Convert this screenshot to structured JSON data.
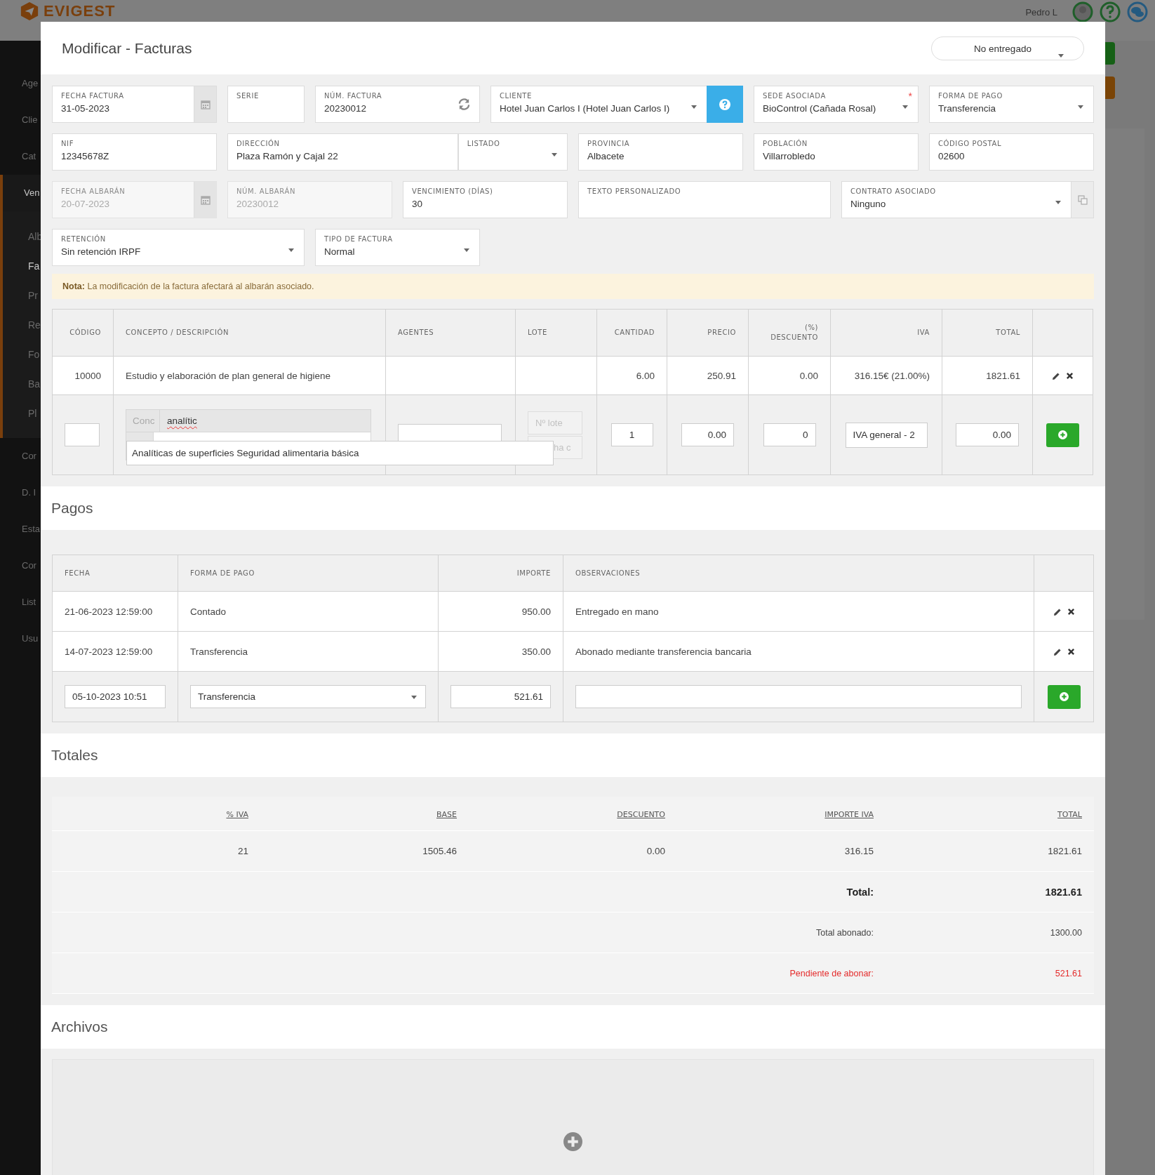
{
  "app": {
    "logo": "EVIGEST",
    "user": "Pedro L",
    "sidebar": [
      {
        "label": "Age",
        "selected": false
      },
      {
        "label": "Clie",
        "selected": false
      },
      {
        "label": "Cat",
        "selected": false
      },
      {
        "label": "Ven",
        "selected": true,
        "children": [
          {
            "label": "Alb",
            "selected": false
          },
          {
            "label": "Fa",
            "selected": true
          },
          {
            "label": "Pr",
            "selected": false
          },
          {
            "label": "Re",
            "selected": false
          },
          {
            "label": "Fo",
            "selected": false
          },
          {
            "label": "Ba",
            "selected": false
          },
          {
            "label": "Pl",
            "selected": false
          }
        ]
      },
      {
        "label": "Cor",
        "selected": false
      },
      {
        "label": "D. I",
        "selected": false
      },
      {
        "label": "Esta",
        "selected": false
      },
      {
        "label": "Cor",
        "selected": false
      },
      {
        "label": "List",
        "selected": false
      },
      {
        "label": "Usu",
        "selected": false
      }
    ]
  },
  "invoice": {
    "title": "Modificar - Facturas",
    "status": "No entregado",
    "required_symbol": "*",
    "form_rows": [
      [
        {
          "kind": "date",
          "label": "FECHA FACTURA",
          "value": "31-05-2023",
          "required": false,
          "disabled": false
        },
        {
          "kind": "text",
          "label": "SERIE",
          "required": false,
          "disabled": false
        },
        {
          "kind": "refresh",
          "label": "NÚM. FACTURA",
          "value": "20230012",
          "required": false,
          "disabled": false
        },
        {
          "kind": "client",
          "label": "CLIENTE",
          "value": "Hotel Juan Carlos I (Hotel Juan Carlos I)",
          "required": false,
          "disabled": false
        },
        {
          "kind": "select",
          "label": "SEDE ASOCIADA",
          "value": "BioControl (Cañada Rosal)",
          "required": true,
          "disabled": false
        },
        {
          "kind": "select",
          "label": "FORMA DE PAGO",
          "value": "Transferencia",
          "required": false,
          "disabled": false
        }
      ],
      [
        {
          "kind": "text",
          "label": "NIF",
          "value": "12345678Z",
          "required": false,
          "disabled": false
        },
        {
          "kind": "text",
          "label": "DIRECCIÓN",
          "value": "Plaza Ramón y Cajal 22",
          "required": false,
          "disabled": false
        },
        {
          "kind": "attached-select",
          "label": "LISTADO",
          "required": false,
          "disabled": false
        },
        {
          "kind": "text",
          "label": "PROVINCIA",
          "value": "Albacete",
          "required": false,
          "disabled": false
        },
        {
          "kind": "text",
          "label": "POBLACIÓN",
          "value": "Villarrobledo",
          "required": false,
          "disabled": false
        },
        {
          "kind": "text",
          "label": "CÓDIGO POSTAL",
          "value": "02600",
          "required": false,
          "disabled": false
        }
      ],
      [
        {
          "kind": "date",
          "label": "FECHA ALBARÁN",
          "value": "20-07-2023",
          "required": false,
          "disabled": true
        },
        {
          "kind": "text",
          "label": "NÚM. ALBARÁN",
          "value": "20230012",
          "required": false,
          "disabled": true
        },
        {
          "kind": "text",
          "label": "VENCIMIENTO (DÍAS)",
          "value": "30",
          "required": false,
          "disabled": false
        },
        {
          "kind": "text",
          "label": "TEXTO PERSONALIZADO",
          "required": false,
          "disabled": false
        },
        {
          "kind": "copy-select",
          "label": "CONTRATO ASOCIADO",
          "value": "Ninguno",
          "required": false,
          "disabled": false
        }
      ],
      [
        {
          "kind": "select",
          "label": "RETENCIÓN",
          "value": "Sin retención IRPF",
          "required": false,
          "disabled": false
        },
        {
          "kind": "select",
          "label": "TIPO DE FACTURA",
          "value": "Normal",
          "required": false,
          "disabled": false
        }
      ]
    ],
    "note": "**Nota:** La modificación de la factura afectará al albarán asociado.",
    "items": {
      "columns": [
        "CÓDIGO",
        "CONCEPTO / DESCRIPCIÓN",
        "AGENTES",
        "LOTE",
        "CANTIDAD",
        "PRECIO",
        "(%)\nDESCUENTO",
        "IVA",
        "TOTAL"
      ],
      "rows": [
        {
          "codigo": "10000",
          "concepto": "Estudio y elaboración de plan general de higiene",
          "cantidad": "6.00",
          "precio": "250.91",
          "descuento": "0.00",
          "iva": "316.15€ (21.00%)",
          "total": "1821.61"
        }
      ],
      "new_row": {
        "concepto_addon": "Conc",
        "concepto_value": "analític",
        "lote_placeholder": "Nº lote",
        "fecha_placeholder": "ha c",
        "cantidad": "1",
        "precio": "0.00",
        "descuento": "0",
        "iva": "IVA general - 2",
        "total": "0.00"
      },
      "suggestions": [
        "Analíticas de superficies Seguridad alimentaria básica"
      ]
    }
  },
  "payments": {
    "title": "Pagos",
    "columns": [
      "FECHA",
      "FORMA DE PAGO",
      "IMPORTE",
      "OBSERVACIONES"
    ],
    "rows": [
      {
        "fecha": "21-06-2023 12:59:00",
        "forma": "Contado",
        "importe": "950.00",
        "observaciones": "Entregado en mano"
      },
      {
        "fecha": "14-07-2023 12:59:00",
        "forma": "Transferencia",
        "importe": "350.00",
        "observaciones": "Abonado mediante transferencia bancaria"
      }
    ],
    "new_row": {
      "fecha": "05-10-2023 10:51",
      "forma": "Transferencia",
      "importe": "521.61"
    }
  },
  "totals": {
    "title": "Totales",
    "columns": [
      "% IVA",
      "BASE",
      "DESCUENTO",
      "IMPORTE IVA",
      "TOTAL"
    ],
    "rows": [
      [
        "21",
        "1505.46",
        "0.00",
        "316.15",
        "1821.61"
      ]
    ],
    "summary": [
      {
        "kind": "grand",
        "label": "Total:",
        "value": "1821.61"
      },
      {
        "kind": "normal",
        "label": "Total abonado:",
        "value": "1300.00"
      },
      {
        "kind": "alert",
        "label": "Pendiente de abonar:",
        "value": "521.61"
      }
    ]
  },
  "files": {
    "title": "Archivos"
  }
}
